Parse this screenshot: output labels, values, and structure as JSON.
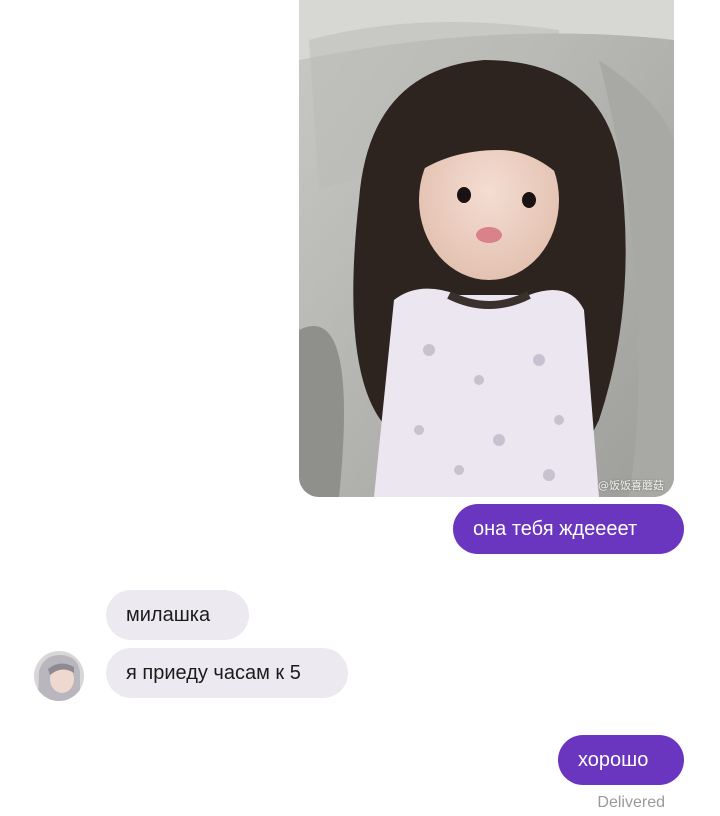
{
  "conversation": {
    "photo": {
      "icon": "photo-of-little-girl",
      "watermark": "@饭饭喜蘑菇"
    },
    "messages": [
      {
        "direction": "outgoing",
        "text": "она тебя ждеееет"
      },
      {
        "direction": "incoming",
        "text": "милашка"
      },
      {
        "direction": "incoming",
        "text": "я приеду часам к 5"
      },
      {
        "direction": "outgoing",
        "text": "хорошо"
      }
    ],
    "status": "Delivered"
  },
  "colors": {
    "outgoing_bubble": "#6a35bf",
    "incoming_bubble": "#eceaf0",
    "status_text": "#9a9a9a"
  }
}
